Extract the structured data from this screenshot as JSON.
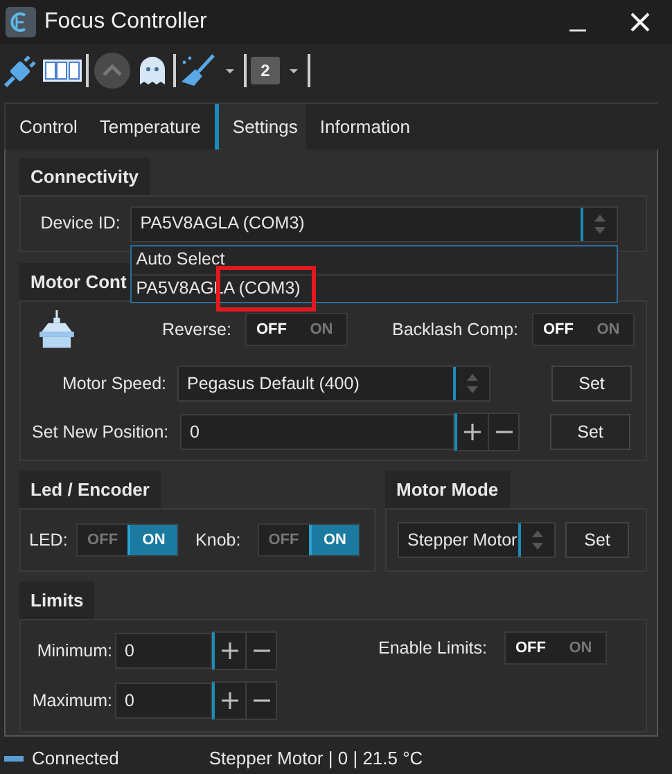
{
  "window": {
    "title": "Focus Controller"
  },
  "toolbar": [
    {
      "kind": "plug"
    },
    {
      "kind": "counter"
    },
    {
      "kind": "separator"
    },
    {
      "kind": "up",
      "disabled": true
    },
    {
      "kind": "ghost"
    },
    {
      "kind": "separator"
    },
    {
      "kind": "broom",
      "menu": true
    },
    {
      "kind": "separator"
    },
    {
      "kind": "profile",
      "text": "2",
      "menu": true
    },
    {
      "kind": "separator"
    }
  ],
  "tabs": [
    {
      "label": "Control",
      "selected": false
    },
    {
      "label": "Temperature",
      "selected": false
    },
    {
      "label": "Settings",
      "selected": true
    },
    {
      "label": "Information",
      "selected": false
    }
  ],
  "connectivity": {
    "title": "Connectivity",
    "device_label": "Device ID:",
    "device_value": "PA5V8AGLA (COM3)",
    "expanded": true,
    "options": [
      {
        "label": "Auto Select",
        "highlight": false
      },
      {
        "label": "PA5V8AGLA (COM3)",
        "highlight": true
      }
    ]
  },
  "motor_control": {
    "title": "Motor Cont",
    "reverse": {
      "label": "Reverse:",
      "off_text": "OFF",
      "on_text": "ON",
      "on": false
    },
    "backlash": {
      "label": "Backlash Comp:",
      "off_text": "OFF",
      "on_text": "ON",
      "on": false
    },
    "speed": {
      "label": "Motor Speed:",
      "value": "Pegasus Default (400)",
      "button": "Set"
    },
    "position": {
      "label": "Set New Position:",
      "value": "0",
      "button": "Set"
    }
  },
  "led_encoder": {
    "title": "Led / Encoder",
    "led": {
      "label": "LED:",
      "off_text": "OFF",
      "on_text": "ON",
      "on": true
    },
    "knob": {
      "label": "Knob:",
      "off_text": "OFF",
      "on_text": "ON",
      "on": true
    }
  },
  "motor_mode": {
    "title": "Motor Mode",
    "value": "Stepper Motor",
    "button": "Set"
  },
  "limits": {
    "title": "Limits",
    "minimum": {
      "label": "Minimum:",
      "value": "0"
    },
    "maximum": {
      "label": "Maximum:",
      "value": "0"
    },
    "enable": {
      "label": "Enable Limits:",
      "off_text": "OFF",
      "on_text": "ON",
      "on": false
    }
  },
  "status_bar": {
    "connected": true,
    "status": "Connected",
    "info": "Stepper Motor | 0 | 21.5 °C"
  }
}
